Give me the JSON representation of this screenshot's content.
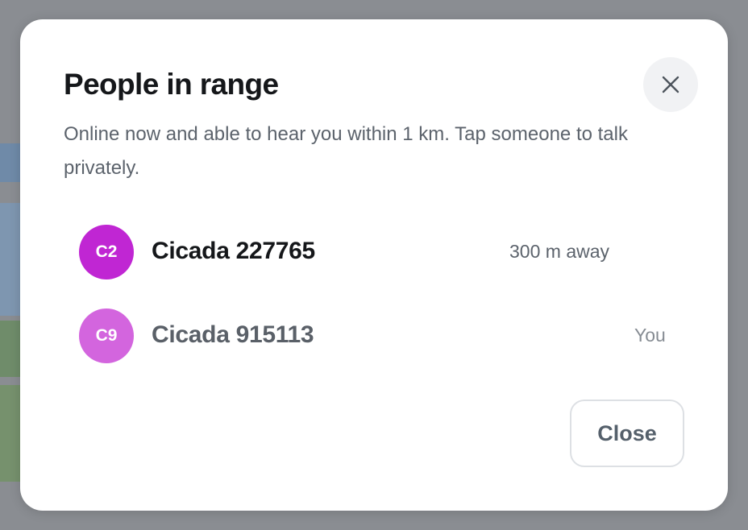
{
  "dialog": {
    "title": "People in range",
    "subtitle": "Online now and able to hear you within 1 km. Tap someone to talk privately.",
    "close_button_label": "Close",
    "close_icon": "close-icon"
  },
  "people": [
    {
      "initials": "C2",
      "name": "Cicada 227765",
      "meta": "300 m away",
      "avatar_color": "#c026d3",
      "name_color": "#15171a"
    },
    {
      "initials": "C9",
      "name": "Cicada 915113",
      "meta": "You",
      "avatar_color": "#d365de",
      "name_color": "#5a6068"
    }
  ]
}
